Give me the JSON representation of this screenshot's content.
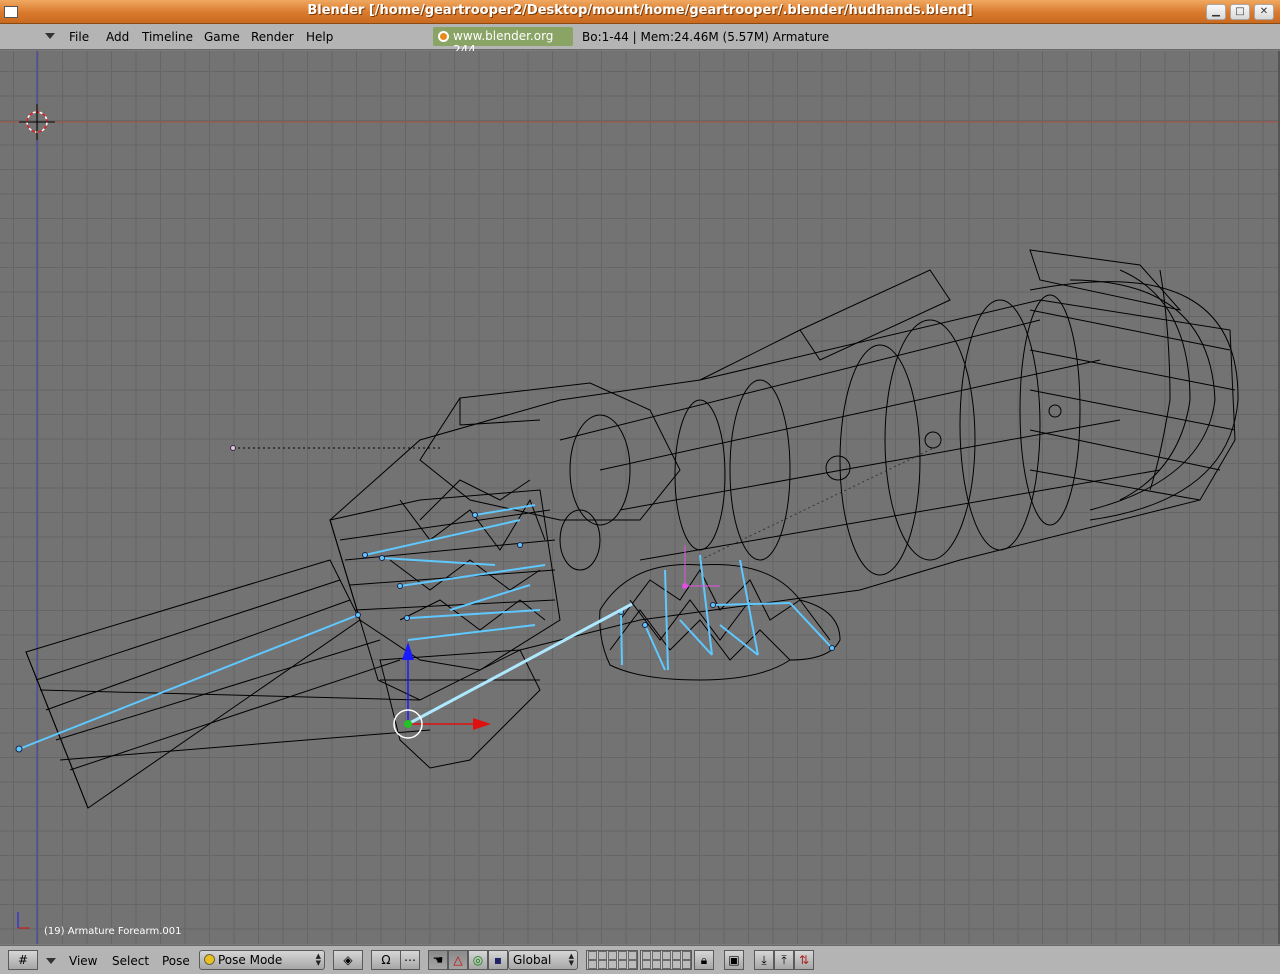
{
  "window": {
    "title": "Blender [/home/geartrooper2/Desktop/mount/home/geartrooper/.blender/hudhands.blend]",
    "controls": {
      "minimize": "▁",
      "maximize": "□",
      "close": "✕"
    }
  },
  "menubar": {
    "items": [
      "File",
      "Add",
      "Timeline",
      "Game",
      "Render",
      "Help"
    ],
    "site_label": "www.blender.org 244",
    "info": "Bo:1-44  | Mem:24.46M (5.57M) Armature"
  },
  "viewport": {
    "status": "(19) Armature Forearm.001"
  },
  "bottombar": {
    "menus": [
      "View",
      "Select",
      "Pose"
    ],
    "mode": "Pose Mode",
    "orientation": "Global"
  },
  "colors": {
    "titlebar": "#d97a2e",
    "viewport_bg": "#737373",
    "bone": "#5fc8ff",
    "active_bone": "#aee8ff"
  },
  "icons": {
    "window": "window-icon",
    "viewport_type": "grid-icon",
    "blender_logo": "blender-logo-icon",
    "draw_type": "draw-type-icon",
    "pivot": "pivot-icon",
    "manipulator": "hand-icon",
    "translate": "triangle-icon",
    "rotate": "ring-icon",
    "scale": "square-icon",
    "lock": "lock-icon",
    "render": "render-icon",
    "paste_pose": "paste-pose-icon",
    "copy_pose": "copy-pose-icon",
    "flip_pose": "flip-pose-icon"
  }
}
